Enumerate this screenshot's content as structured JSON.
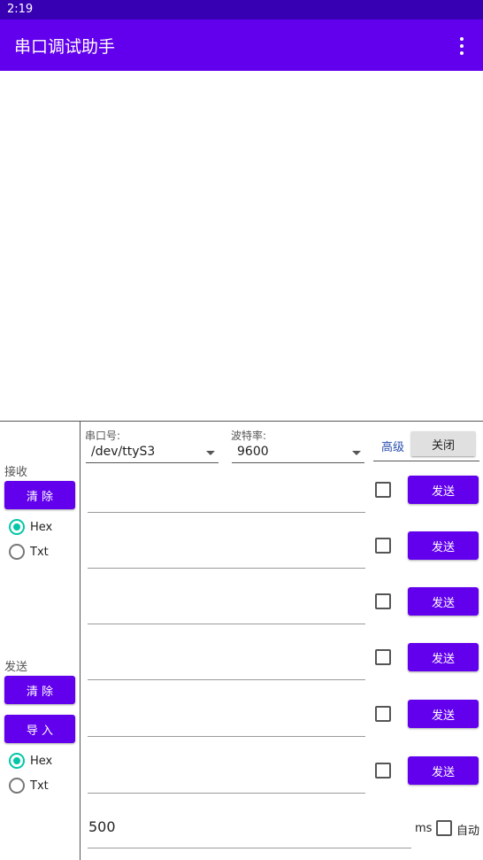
{
  "status_bar": {
    "time": "2:19"
  },
  "app_bar": {
    "title": "串口调试助手",
    "menu_icon": "more-vert-icon"
  },
  "receive": {
    "section_label": "接收",
    "clear_label": "清 除",
    "format_options": [
      "Hex",
      "Txt"
    ],
    "selected_format": "Hex"
  },
  "send": {
    "section_label": "发送",
    "clear_label": "清 除",
    "import_label": "导 入",
    "format_options": [
      "Hex",
      "Txt"
    ],
    "selected_format": "Hex"
  },
  "port": {
    "label": "串口号:",
    "value": "/dev/ttyS3"
  },
  "baud": {
    "label": "波特率:",
    "value": "9600"
  },
  "advanced_label": "高级",
  "close_label": "关闭",
  "send_rows": [
    {
      "value": "",
      "send_label": "发送",
      "checked": false
    },
    {
      "value": "",
      "send_label": "发送",
      "checked": false
    },
    {
      "value": "",
      "send_label": "发送",
      "checked": false
    },
    {
      "value": "",
      "send_label": "发送",
      "checked": false
    },
    {
      "value": "",
      "send_label": "发送",
      "checked": false
    },
    {
      "value": "",
      "send_label": "发送",
      "checked": false
    }
  ],
  "auto_send": {
    "interval_value": "500",
    "unit_label": "ms",
    "auto_label": "自动",
    "checked": false
  },
  "colors": {
    "status_bar": "#3700b3",
    "app_bar": "#6200ee",
    "button": "#6200ee",
    "radio_accent": "#03c6a8"
  }
}
